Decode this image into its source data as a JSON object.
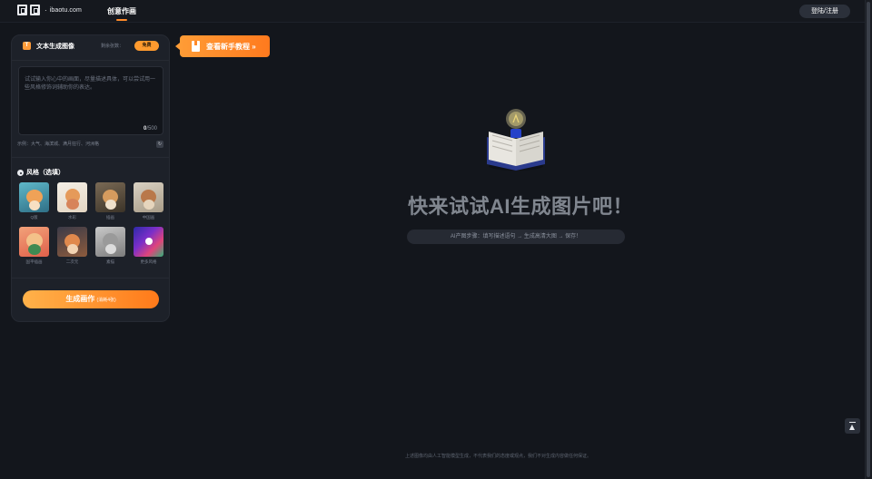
{
  "header": {
    "logo_text": "ibaotu.com",
    "nav_tab": "创意作画",
    "login_label": "登陆/注册"
  },
  "panel": {
    "title": "文本生成图像",
    "remaining_label": "剩余张数：",
    "free_badge": "免费",
    "prompt_placeholder": "试试输入你心中的画面，尽量描述具体，可以尝试用一些风格修饰词辅助你的表达。",
    "char_count": "0",
    "char_limit": "/500",
    "examples": "示例：大气、海滨城、满月狂行、河洲格",
    "style_title": "风格（选填）",
    "styles": [
      {
        "label": "Q版"
      },
      {
        "label": "水彩"
      },
      {
        "label": "插画"
      },
      {
        "label": "中国画"
      },
      {
        "label": "国平插画"
      },
      {
        "label": "二次元"
      },
      {
        "label": "素描"
      },
      {
        "label": "更多风格"
      }
    ],
    "generate_label": "生成画作",
    "generate_note": "(消耗4张)"
  },
  "tutorial": {
    "label": "查看新手教程 »"
  },
  "main": {
    "hero_title": "快来试试AI生成图片吧！",
    "steps": "AI产图步骤：填写描述语句 → 生成高清大图 → 保存！",
    "footer_note": "上述图像均由人工智能模型生成，不代表我们的态度或观点，我们不对生成内容做任何保证。"
  },
  "colors": {
    "accent": "#ff8a2a",
    "background": "#13161c",
    "panel": "#1d2129"
  }
}
